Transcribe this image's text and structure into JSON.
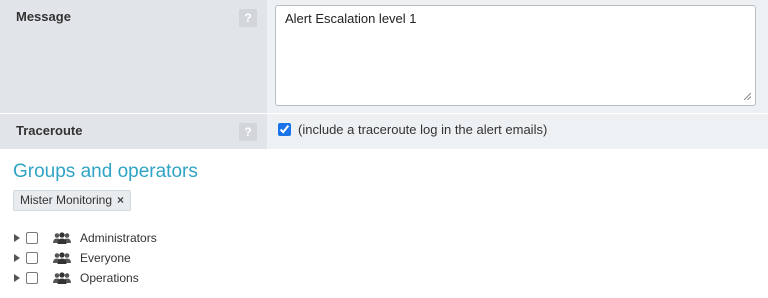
{
  "form": {
    "message": {
      "label": "Message",
      "help": "?",
      "value": "Alert Escalation level 1"
    },
    "traceroute": {
      "label": "Traceroute",
      "help": "?",
      "checked": true,
      "text": "(include a traceroute log in the alert emails)"
    }
  },
  "groups": {
    "title": "Groups and operators",
    "selected_tag": "Mister Monitoring",
    "tag_remove": "×",
    "tree": [
      {
        "label": "Administrators",
        "icon": "group-icon",
        "checked": false
      },
      {
        "label": "Everyone",
        "icon": "group-icon",
        "checked": false
      },
      {
        "label": "Operations",
        "icon": "group-icon",
        "checked": false
      }
    ]
  },
  "colors": {
    "label_bg": "#e1e5e9",
    "value_bg": "#eef1f3",
    "accent": "#2fa4c4",
    "checkbox": "#1a73e8"
  }
}
